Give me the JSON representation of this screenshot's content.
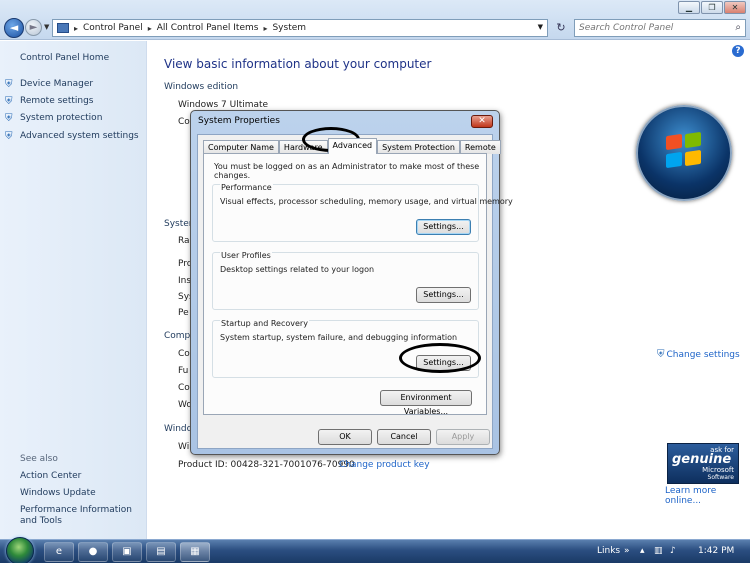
{
  "chrome": {
    "back_glyph": "◄",
    "forward_glyph": "►",
    "breadcrumbs": [
      "Control Panel",
      "All Control Panel Items",
      "System"
    ],
    "search_placeholder": "Search Control Panel",
    "caption_min": "▁",
    "caption_max": "❐",
    "caption_close": "✕"
  },
  "left_nav": {
    "home": "Control Panel Home",
    "links": [
      "Device Manager",
      "Remote settings",
      "System protection",
      "Advanced system settings"
    ],
    "see_also_heading": "See also",
    "see_also": [
      "Action Center",
      "Windows Update",
      "Performance Information and Tools"
    ]
  },
  "main": {
    "title": "View basic information about your computer",
    "windows_edition_heading": "Windows edition",
    "edition_text": "Windows 7 Ultimate",
    "fragments": {
      "copyright": "Co",
      "system_heading": "System",
      "rating": "Ra",
      "processor": "Pro",
      "installed": "Ins",
      "system_type": "Sys",
      "pen": "Pe",
      "computer_heading": "Comp",
      "comp_name": "Co",
      "full_name": "Fu",
      "comp_desc": "Co",
      "workgroup": "Wo",
      "activation_heading": "Windo",
      "activation": "Wi"
    },
    "change_settings": "Change settings",
    "product_id": "Product ID: 00428-321-7001076-70990",
    "change_product_key": "Change product key",
    "genuine": {
      "ask_for": "ask for",
      "word": "genuine",
      "brand": "Microsoft",
      "sub": "Software"
    },
    "learn_more": "Learn more online..."
  },
  "dialog": {
    "title": "System Properties",
    "close_glyph": "✕",
    "tabs": [
      {
        "label": "Computer Name",
        "active": false
      },
      {
        "label": "Hardware",
        "active": false
      },
      {
        "label": "Advanced",
        "active": true
      },
      {
        "label": "System Protection",
        "active": false
      },
      {
        "label": "Remote",
        "active": false
      }
    ],
    "admin_note": "You must be logged on as an Administrator to make most of these changes.",
    "performance": {
      "title": "Performance",
      "desc": "Visual effects, processor scheduling, memory usage, and virtual memory",
      "button": "Settings..."
    },
    "user_profiles": {
      "title": "User Profiles",
      "desc": "Desktop settings related to your logon",
      "button": "Settings..."
    },
    "startup_recovery": {
      "title": "Startup and Recovery",
      "desc": "System startup, system failure, and debugging information",
      "button": "Settings..."
    },
    "env_vars": "Environment Variables...",
    "ok": "OK",
    "cancel": "Cancel",
    "apply": "Apply"
  },
  "taskbar": {
    "links": "Links",
    "chevron": "»",
    "clock": "1:42 PM"
  },
  "colors": {
    "link_blue": "#1e64c8",
    "title_blue": "#1e3287",
    "annotation": "#000000"
  },
  "icons": [
    "shield-icon",
    "search-icon",
    "help-icon",
    "windows-logo",
    "start-orb"
  ]
}
